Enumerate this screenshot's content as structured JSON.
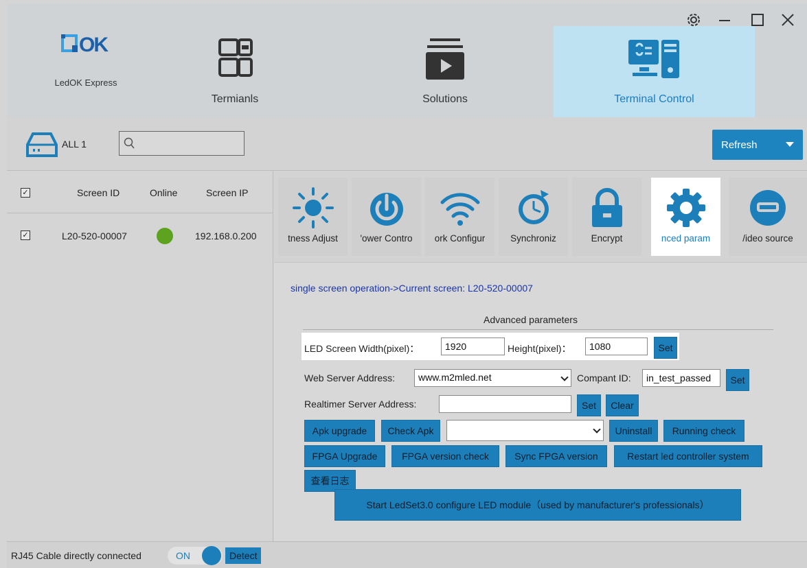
{
  "app": {
    "name": "LedOK Express",
    "logo_text": "OK"
  },
  "nav": {
    "tabs": [
      {
        "label": "Termianls",
        "icon": "terminals-icon"
      },
      {
        "label": "Solutions",
        "icon": "solutions-icon"
      },
      {
        "label": "Terminal Control",
        "icon": "terminal-control-icon"
      }
    ],
    "active_tab": "Terminal Control"
  },
  "window_controls": [
    "settings-icon",
    "minimize-icon",
    "maximize-icon",
    "close-icon"
  ],
  "toolbar": {
    "all_label": "ALL 1",
    "search_placeholder": "",
    "refresh_label": "Refresh"
  },
  "device_list": {
    "columns": [
      "Screen ID",
      "Online",
      "Screen IP"
    ],
    "rows": [
      {
        "screen_id": "L20-520-00007",
        "online": true,
        "screen_ip": "192.168.0.200",
        "checked": true
      }
    ]
  },
  "function_tiles": [
    {
      "label": "tness Adjust",
      "icon": "brightness-icon"
    },
    {
      "label": "'ower Contro",
      "icon": "power-icon"
    },
    {
      "label": "ork Configur",
      "icon": "wifi-icon"
    },
    {
      "label": "Synchroniz",
      "icon": "clock-sync-icon"
    },
    {
      "label": "Encrypt",
      "icon": "lock-icon"
    },
    {
      "label": "nced param",
      "icon": "gear-icon"
    },
    {
      "label": "/ideo source",
      "icon": "video-source-icon"
    }
  ],
  "active_function": "nced param",
  "content": {
    "breadcrumb": "single screen operation->Current screen: L20-520-00007",
    "section_title": "Advanced parameters",
    "width_label": "LED Screen Width(pixel)：",
    "width_value": "1920",
    "height_label": "Height(pixel)：",
    "height_value": "1080",
    "set_label": "Set",
    "web_server_label": "Web Server Address:",
    "web_server_value": "www.m2mled.net",
    "company_id_label": "Compant ID:",
    "company_id_value": "in_test_passed",
    "realtimer_label": "Realtimer Server Address:",
    "realtimer_value": "",
    "clear_label": "Clear",
    "apk_upgrade_label": "Apk upgrade",
    "check_apk_label": "Check Apk",
    "apk_select_value": "",
    "uninstall_label": "Uninstall",
    "running_check_label": "Running check",
    "fpga_upgrade_label": "FPGA Upgrade",
    "fpga_version_check_label": "FPGA version check",
    "sync_fpga_label": "Sync FPGA version",
    "restart_label": "Restart led controller system",
    "view_log_label": "查看日志",
    "ledset_label": "Start LedSet3.0 configure LED module（used by manufacturer's professionals）"
  },
  "status_bar": {
    "connection_text": "RJ45 Cable directly connected",
    "toggle_label": "ON",
    "toggle_on": true,
    "detect_label": "Detect"
  },
  "colors": {
    "accent": "#1c7fb9",
    "active_tab_bg": "#bfe2f2",
    "online": "#5da31f",
    "breadcrumb": "#1a35a8"
  }
}
